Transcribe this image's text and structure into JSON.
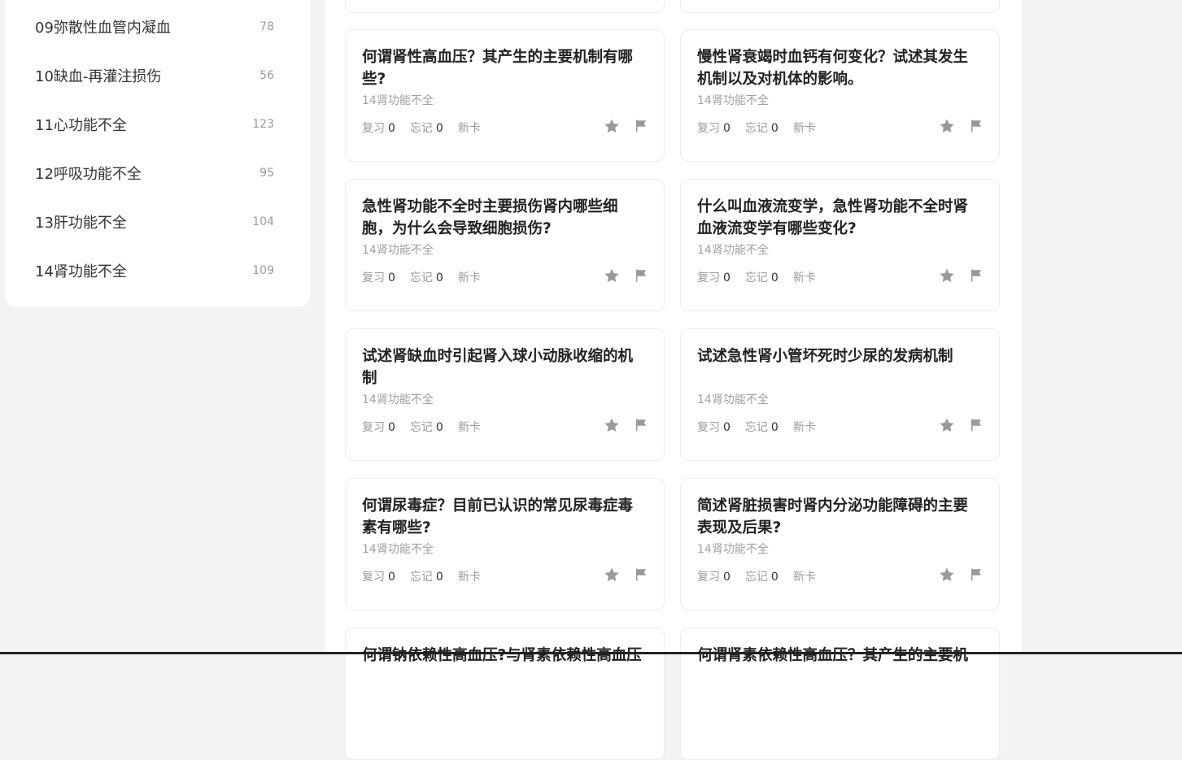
{
  "sidebar": {
    "items": [
      {
        "name": "09弥散性血管内凝血",
        "count": "78"
      },
      {
        "name": "10缺血-再灌注损伤",
        "count": "56"
      },
      {
        "name": "11心功能不全",
        "count": "123"
      },
      {
        "name": "12呼吸功能不全",
        "count": "95"
      },
      {
        "name": "13肝功能不全",
        "count": "104"
      },
      {
        "name": "14肾功能不全",
        "count": "109"
      }
    ]
  },
  "labels": {
    "review": "复习",
    "forget": "忘记",
    "new_card": "新卡"
  },
  "cards": [
    {
      "title": "何谓肾性高血压？其产生的主要机制有哪些?",
      "category": "14肾功能不全",
      "review": "0",
      "forget": "0"
    },
    {
      "title": "慢性肾衰竭时血钙有何变化？试述其发生机制以及对机体的影响。",
      "category": "14肾功能不全",
      "review": "0",
      "forget": "0"
    },
    {
      "title": "急性肾功能不全时主要损伤肾内哪些细胞，为什么会导致细胞损伤?",
      "category": "14肾功能不全",
      "review": "0",
      "forget": "0"
    },
    {
      "title": "什么叫血液流变学，急性肾功能不全时肾血液流变学有哪些变化?",
      "category": "14肾功能不全",
      "review": "0",
      "forget": "0"
    },
    {
      "title": "试述肾缺血时引起肾入球小动脉收缩的机制",
      "category": "14肾功能不全",
      "review": "0",
      "forget": "0"
    },
    {
      "title": "试述急性肾小管坏死时少尿的发病机制",
      "category": "14肾功能不全",
      "review": "0",
      "forget": "0"
    },
    {
      "title": "何谓尿毒症？目前已认识的常见尿毒症毒素有哪些?",
      "category": "14肾功能不全",
      "review": "0",
      "forget": "0"
    },
    {
      "title": "简述肾脏损害时肾内分泌功能障碍的主要表现及后果?",
      "category": "14肾功能不全",
      "review": "0",
      "forget": "0"
    },
    {
      "title": "何谓钠依赖性高血压?与肾素依赖性高血压",
      "category": "",
      "review": "",
      "forget": ""
    },
    {
      "title": "何谓肾素依赖性高血压？其产生的主要机",
      "category": "",
      "review": "",
      "forget": ""
    }
  ],
  "colors": {
    "page_bg": "#f3f3f3",
    "icon_gray": "#999999",
    "title_text": "#222222"
  },
  "icons": [
    "star-icon",
    "flag-icon"
  ]
}
